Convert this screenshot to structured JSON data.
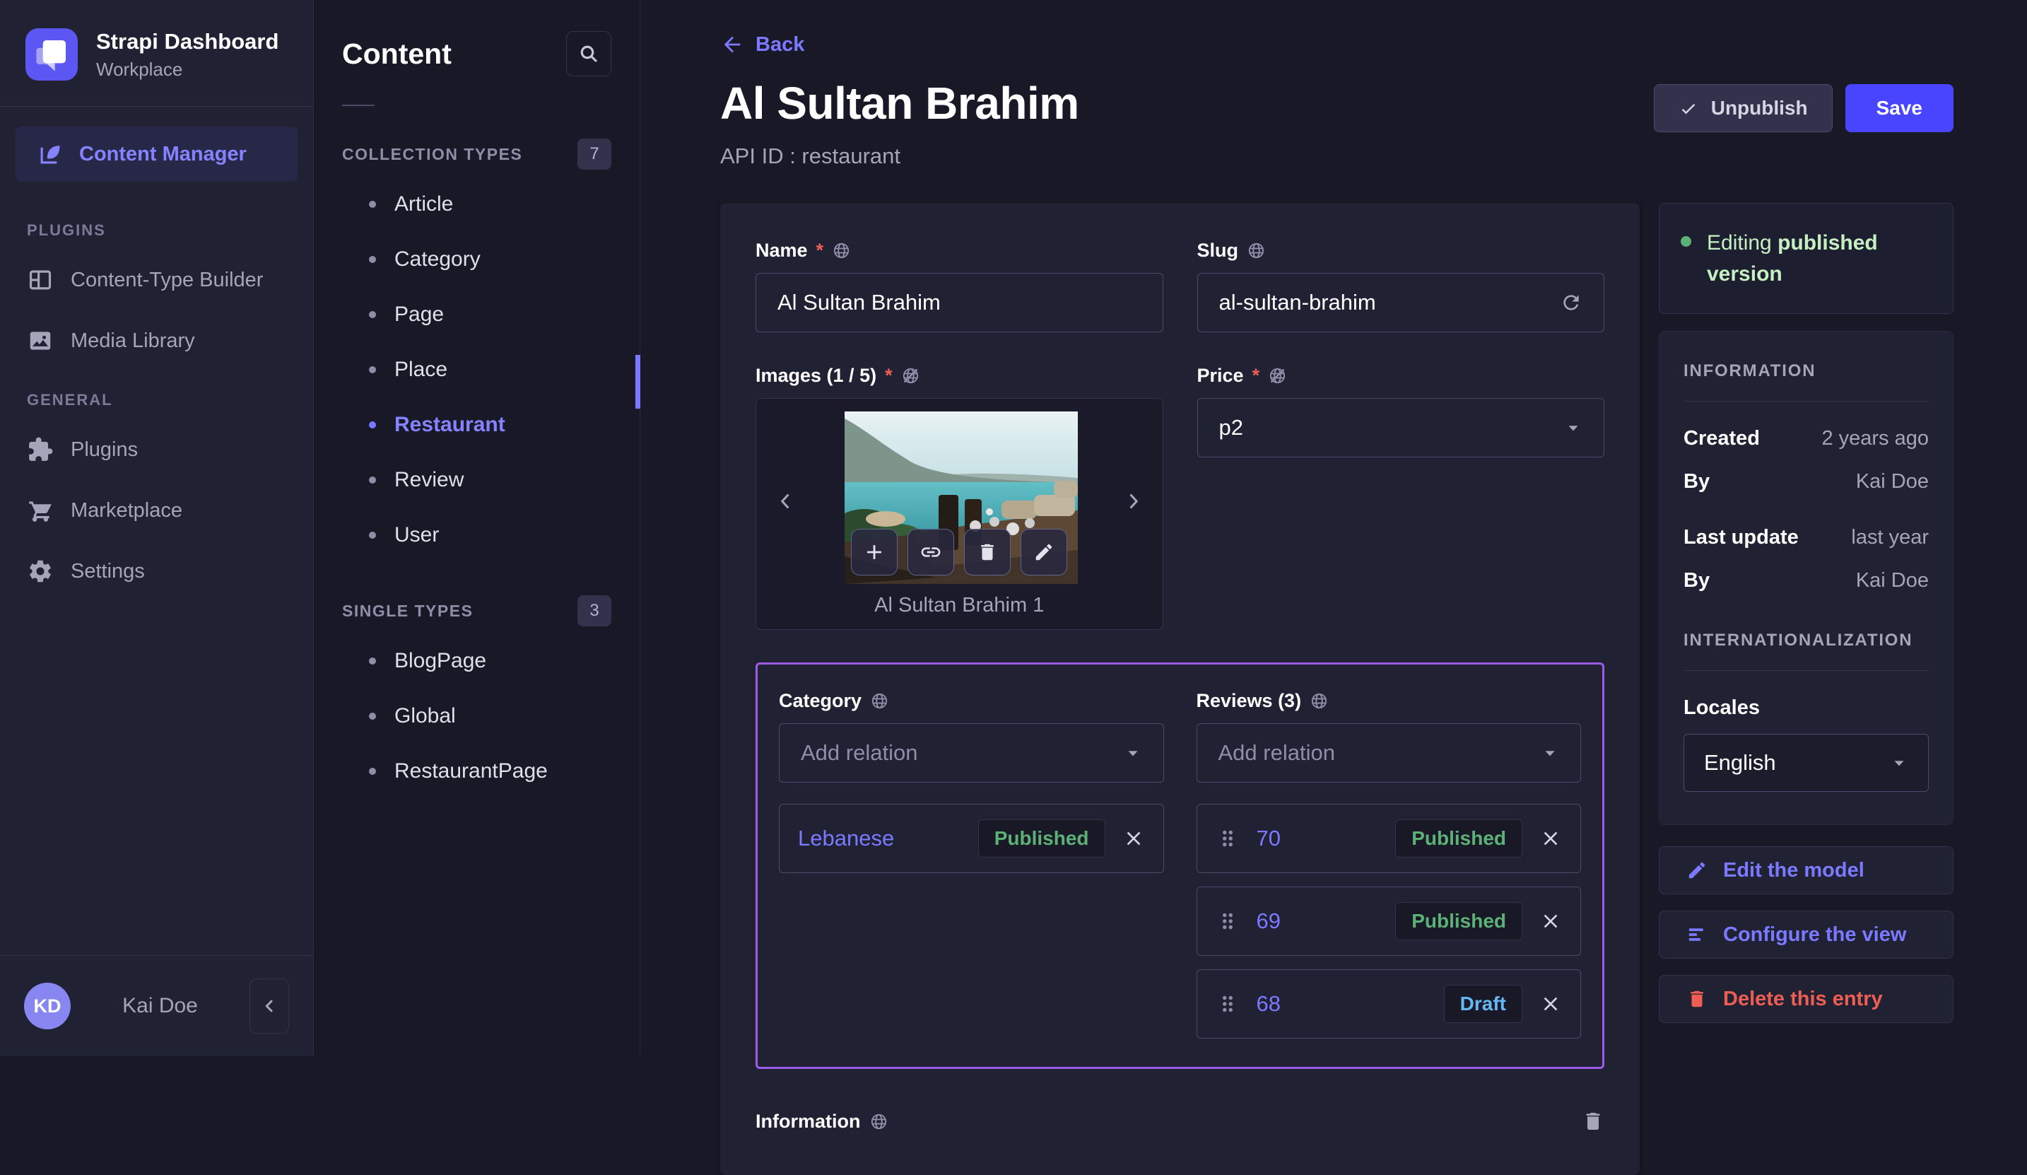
{
  "colors": {
    "app_bg": "#181826",
    "surface": "#212134",
    "primary": "#4945ff",
    "primary_light": "#7b79ff",
    "success": "#5cb176",
    "success_light": "#c6f0c2",
    "draft_blue": "#66b7f1",
    "danger": "#ee5e52",
    "relation_border": "#9d5ce8"
  },
  "icons": [
    "strapi-logo",
    "edit-feather-icon",
    "layout-icon",
    "image-icon",
    "puzzle-icon",
    "cart-icon",
    "gear-icon",
    "chevron-left-icon",
    "chevron-right-icon",
    "search-icon",
    "arrow-left-icon",
    "check-icon",
    "globe-icon",
    "globe-slash-icon",
    "refresh-icon",
    "caret-down-icon",
    "plus-icon",
    "link-icon",
    "trash-icon",
    "pencil-icon",
    "close-icon",
    "drag-handle-icon",
    "list-lines-icon"
  ],
  "app": {
    "title": "Strapi Dashboard",
    "workspace": "Workplace"
  },
  "nav": {
    "content_manager": "Content Manager",
    "sections": [
      {
        "label": "PLUGINS",
        "items": [
          {
            "label": "Content-Type Builder"
          },
          {
            "label": "Media Library"
          }
        ]
      },
      {
        "label": "GENERAL",
        "items": [
          {
            "label": "Plugins"
          },
          {
            "label": "Marketplace"
          },
          {
            "label": "Settings"
          }
        ]
      }
    ],
    "user": {
      "initials": "KD",
      "name": "Kai Doe"
    }
  },
  "subnav": {
    "title": "Content",
    "sections": [
      {
        "label": "COLLECTION TYPES",
        "count": "7",
        "items": [
          "Article",
          "Category",
          "Page",
          "Place",
          "Restaurant",
          "Review",
          "User"
        ]
      },
      {
        "label": "SINGLE TYPES",
        "count": "3",
        "items": [
          "BlogPage",
          "Global",
          "RestaurantPage"
        ]
      }
    ]
  },
  "header": {
    "back": "Back",
    "title": "Al Sultan Brahim",
    "subtitle": "API ID : restaurant",
    "unpublish_label": "Unpublish",
    "save_label": "Save"
  },
  "form": {
    "name": {
      "label": "Name",
      "required": "*",
      "value": "Al Sultan Brahim"
    },
    "slug": {
      "label": "Slug",
      "value": "al-sultan-brahim"
    },
    "images": {
      "label": "Images (1 / 5)",
      "required": "*",
      "caption": "Al Sultan Brahim 1"
    },
    "price": {
      "label": "Price",
      "required": "*",
      "value": "p2"
    },
    "category": {
      "label": "Category",
      "placeholder": "Add relation",
      "relation": {
        "name": "Lebanese",
        "status": "Published"
      }
    },
    "reviews": {
      "label": "Reviews (3)",
      "placeholder": "Add relation",
      "rows": [
        {
          "id": "70",
          "status": "Published"
        },
        {
          "id": "69",
          "status": "Published"
        },
        {
          "id": "68",
          "status": "Draft"
        }
      ]
    },
    "information": {
      "label": "Information"
    }
  },
  "panel": {
    "version": {
      "prefix": "Editing ",
      "emphasis": "published version"
    },
    "information": {
      "title": "INFORMATION",
      "rows": [
        {
          "label": "Created",
          "value": "2 years ago"
        },
        {
          "label": "By",
          "value": "Kai Doe"
        },
        {
          "label": "Last update",
          "value": "last year"
        },
        {
          "label": "By",
          "value": "Kai Doe"
        }
      ]
    },
    "i18n": {
      "title": "INTERNATIONALIZATION",
      "locales_label": "Locales",
      "locale_value": "English"
    },
    "actions": [
      {
        "label": "Edit the model"
      },
      {
        "label": "Configure the view"
      },
      {
        "label": "Delete this entry"
      }
    ]
  }
}
